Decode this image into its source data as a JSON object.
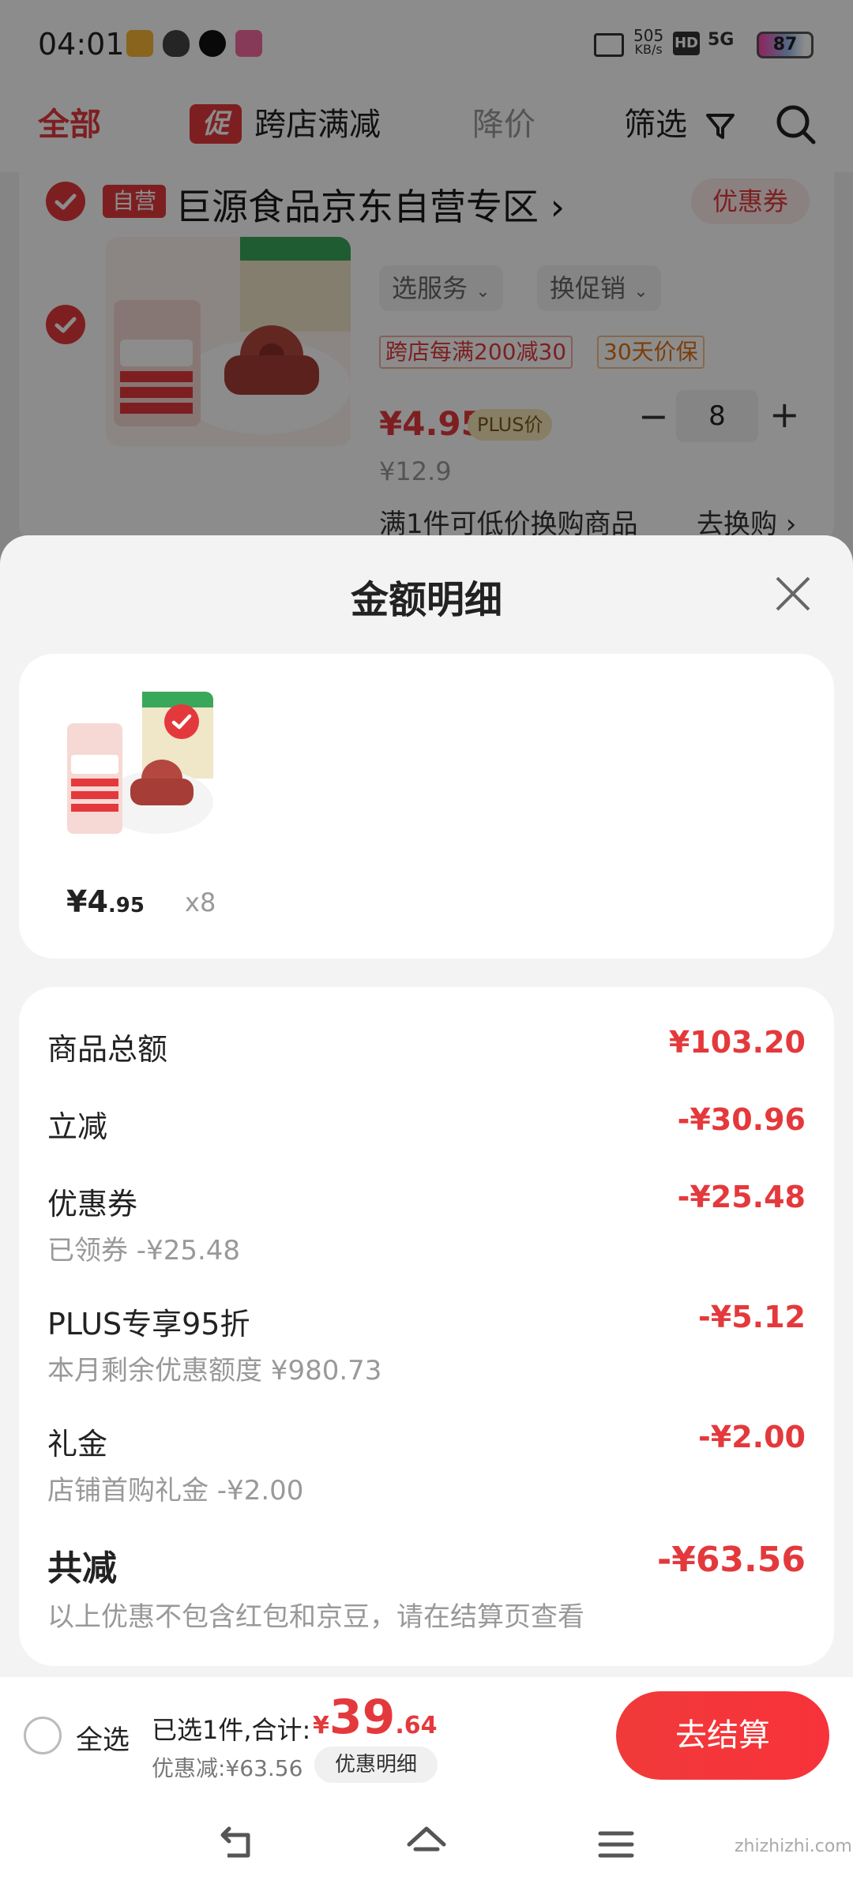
{
  "status_bar": {
    "time": "04:01",
    "net_speed_top": "505",
    "net_speed_unit": "KB/s",
    "hd": "HD",
    "signal": "5G",
    "battery": "87",
    "icons": [
      "app-cat-icon",
      "shield-icon",
      "qq-icon",
      "app-pink-icon",
      "vibrate-icon"
    ]
  },
  "top_bar": {
    "all": "全部",
    "promo_badge": "促",
    "cross_store": "跨店满减",
    "price_drop": "降价",
    "filter": "筛选"
  },
  "store": {
    "self_badge": "自营",
    "name": "巨源食品京东自营专区",
    "chevron": "›",
    "coupon": "优惠券"
  },
  "product": {
    "service_btn": "选服务",
    "promo_btn": "换促销",
    "tag_cross": "跨店每满200减30",
    "tag_guarantee": "30天价保",
    "price": "¥4.95",
    "plus_label": "PLUS价",
    "qty_minus": "−",
    "qty": "8",
    "qty_plus": "+",
    "orig_price": "¥12.9",
    "swap_text": "满1件可低价换购商品",
    "swap_link": "去换购 ›"
  },
  "sheet": {
    "title": "金额明细",
    "item": {
      "price_main": "¥4",
      "price_dec": ".95",
      "qty": "x8"
    },
    "rows": [
      {
        "label": "商品总额",
        "value": "¥103.20",
        "sub": ""
      },
      {
        "label": "立减",
        "value": "-¥30.96",
        "sub": ""
      },
      {
        "label": "优惠券",
        "value": "-¥25.48",
        "sub": "已领券 -¥25.48"
      },
      {
        "label": "PLUS专享95折",
        "value": "-¥5.12",
        "sub": "本月剩余优惠额度 ¥980.73"
      },
      {
        "label": "礼金",
        "value": "-¥2.00",
        "sub": "店铺首购礼金 -¥2.00"
      },
      {
        "label": "共减",
        "value": "-¥63.56",
        "sub": "以上优惠不包含红包和京豆，请在结算页查看"
      }
    ]
  },
  "checkout": {
    "select_all": "全选",
    "selected": "已选1件,合计:",
    "yen": "¥",
    "amount_int": "39",
    "amount_dec": ".64",
    "discount": "优惠减:¥63.56",
    "detail": "优惠明细",
    "button": "去结算"
  },
  "watermark": "zhizhizhi.com",
  "colors": {
    "accent": "#e4393c"
  }
}
